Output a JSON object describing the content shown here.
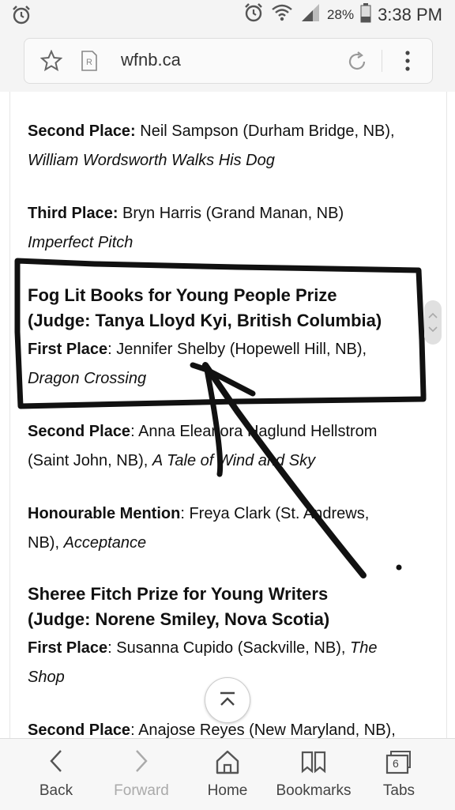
{
  "status_bar": {
    "battery": "28%",
    "time": "3:38 PM"
  },
  "browser": {
    "url": "wfnb.ca"
  },
  "content": {
    "p1": {
      "label": "Second Place:",
      "text": " Neil Sampson (Durham Bridge, NB),",
      "title": "William Wordsworth Walks His Dog"
    },
    "p2": {
      "label": "Third Place:",
      "text": " Bryn Harris (Grand Manan, NB)",
      "title": "Imperfect Pitch"
    },
    "h1_line1": "Fog Lit Books for Young People Prize",
    "h1_line2": "(Judge:  Tanya Lloyd Kyi, British Columbia)",
    "p3": {
      "label": "First Place",
      "text": ":  Jennifer Shelby (Hopewell Hill, NB),",
      "title": "Dragon Crossing"
    },
    "p4": {
      "label": "Second Place",
      "text1": ":  Anna Eleanora Haglund Hellstrom",
      "text2": "(Saint John, NB), ",
      "title": "A Tale of Wind and Sky"
    },
    "p5": {
      "label": "Honourable Mention",
      "text1": ": Freya Clark (St. Andrews,",
      "text2": "NB), ",
      "title": "Acceptance"
    },
    "h2_line1": "Sheree Fitch Prize for Young Writers",
    "h2_line2": "(Judge: Norene Smiley, Nova Scotia)",
    "p6": {
      "label": "First Place",
      "text": ":  Susanna Cupido (Sackville, NB), ",
      "title1": "The",
      "title2": "Shop"
    },
    "p7": {
      "label": "Second Place",
      "text": ":  Anajose Reyes (New Maryland, NB),"
    }
  },
  "bottom_nav": {
    "back": "Back",
    "forward": "Forward",
    "home": "Home",
    "bookmarks": "Bookmarks",
    "tabs": "Tabs",
    "tab_count": "6"
  },
  "icons": [
    "alarm-icon",
    "wifi-icon",
    "signal-icon",
    "battery-icon",
    "star-icon",
    "reader-mode-icon",
    "reload-icon",
    "more-menu-icon",
    "scroll-to-top-icon",
    "back-icon",
    "forward-icon",
    "home-icon",
    "bookmarks-icon",
    "tabs-icon"
  ]
}
